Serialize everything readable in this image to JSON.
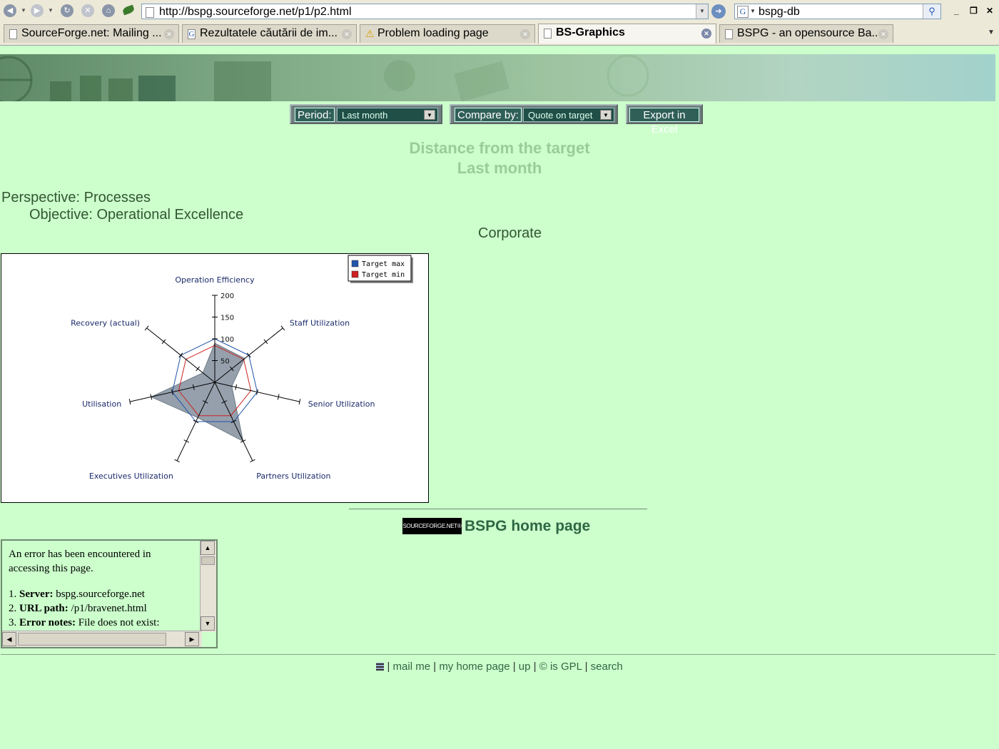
{
  "browser": {
    "url": "http://bspg.sourceforge.net/p1/p2.html",
    "search_text": "bspg-db",
    "tabs": [
      {
        "label": "SourceForge.net: Mailing ...",
        "icon": "page-icon",
        "active": false
      },
      {
        "label": "Rezultatele căutării de im...",
        "icon": "google-icon",
        "active": false
      },
      {
        "label": "Problem loading page",
        "icon": "warning-icon",
        "active": false
      },
      {
        "label": "BS-Graphics",
        "icon": "page-icon",
        "active": true
      },
      {
        "label": "BSPG - an opensource Ba...",
        "icon": "page-icon",
        "active": false
      }
    ]
  },
  "controls": {
    "period_label": "Period:",
    "period_value": "Last month",
    "compare_label": "Compare by:",
    "compare_value": "Quote on target",
    "export_label": "Export in Excel"
  },
  "titles": {
    "line1": "Distance from the target",
    "line2": "Last month",
    "perspective": "Perspective: Processes",
    "objective": "Objective: Operational Excellence",
    "unit": "Corporate"
  },
  "chart_data": {
    "type": "radar",
    "categories": [
      "Operation Efficiency",
      "Staff Utilization",
      "Senior Utilization",
      "Partners Utilization",
      "Executives Utilization",
      "Utilisation",
      "Recovery (actual)"
    ],
    "rticks": [
      50,
      100,
      150,
      200
    ],
    "rlim": [
      0,
      200
    ],
    "legend": [
      "Target max",
      "Target min"
    ],
    "series": [
      {
        "name": "Target max",
        "color": "#2255aa",
        "values": [
          100,
          100,
          100,
          100,
          100,
          100,
          100
        ]
      },
      {
        "name": "Target min",
        "color": "#cc2222",
        "values": [
          85,
          85,
          85,
          85,
          85,
          85,
          85
        ]
      },
      {
        "values": [
          90,
          88,
          40,
          150,
          90,
          150,
          35
        ],
        "color": "#8f9ba8"
      }
    ]
  },
  "home": {
    "logo_text": "SOURCEFORGE.NET®",
    "link_label": "BSPG home page"
  },
  "error": {
    "intro": "An error has been encountered in accessing this page.",
    "items": [
      {
        "num": "1.",
        "key": "Server:",
        "val": " bspg.sourceforge.net"
      },
      {
        "num": "2.",
        "key": "URL path:",
        "val": " /p1/bravenet.html"
      },
      {
        "num": "3.",
        "key": "Error notes:",
        "val": " File does not exist:"
      }
    ]
  },
  "footer": {
    "links": [
      "mail me",
      "my home page",
      "up",
      "© is GPL",
      "search"
    ]
  }
}
